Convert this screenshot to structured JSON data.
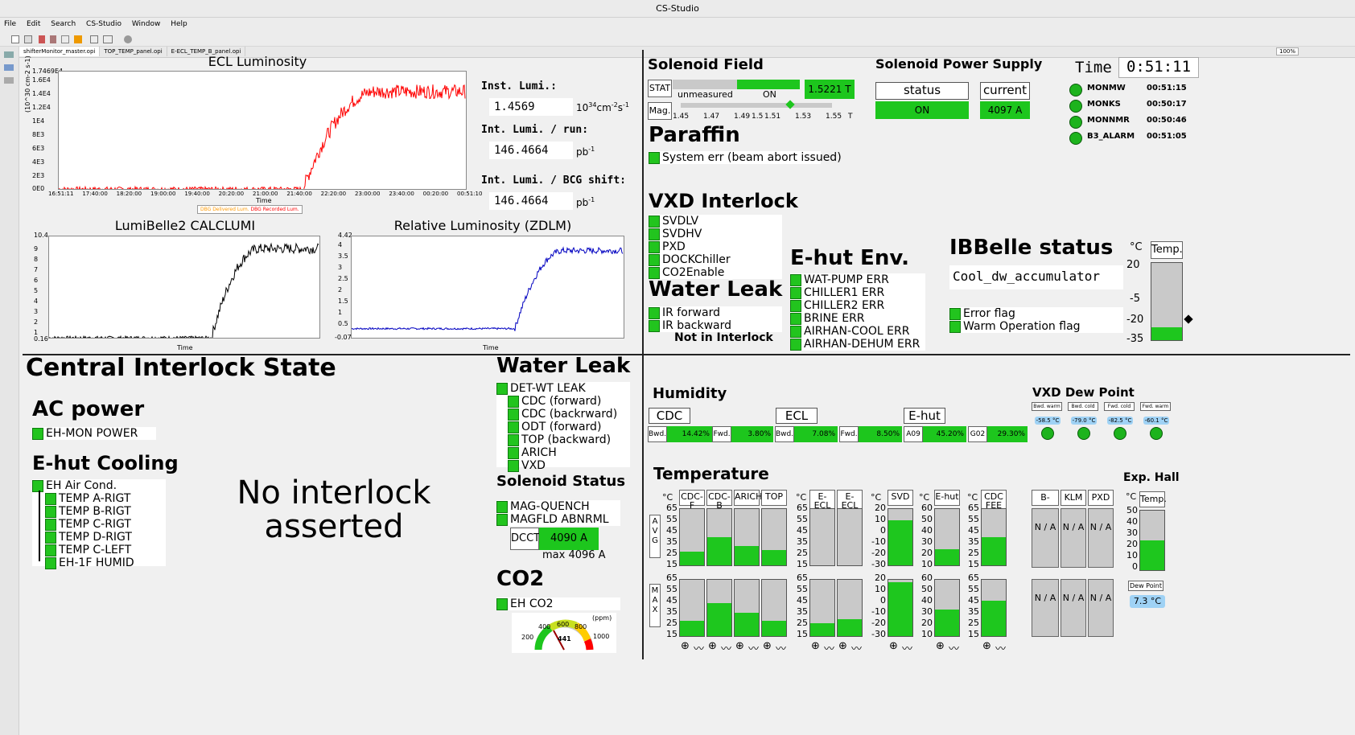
{
  "window": {
    "title": "CS-Studio"
  },
  "menu": [
    "File",
    "Edit",
    "Search",
    "CS-Studio",
    "Window",
    "Help"
  ],
  "tabs": [
    "shifterMonitor_master.opi",
    "TOP_TEMP_panel.opi",
    "E-ECL_TEMP_B_panel.opi"
  ],
  "zoom": "100%",
  "ecl": {
    "title": "ECL Luminosity",
    "ymax_label": "1.7469E4",
    "yticks": [
      "1.6E4",
      "1.4E4",
      "1.2E4",
      "1E4",
      "8E3",
      "6E3",
      "4E3",
      "2E3",
      "0E0"
    ],
    "ylabel": "(10^30 cm-2 s-1)",
    "xticks": [
      "16:51:11",
      "17:40:00",
      "18:20:00",
      "19:00:00",
      "19:40:00",
      "20:20:00",
      "21:00:00",
      "21:40:00",
      "22:20:00",
      "23:00:00",
      "23:40:00",
      "00:20:00",
      "00:51:10"
    ],
    "xlabel": "Time",
    "legend": [
      "DBG Delivered Lum.",
      "DBG Recorded Lum."
    ]
  },
  "lumi": {
    "inst_label": "Inst. Lumi.:",
    "inst_value": "1.4569",
    "inst_unit": "10",
    "inst_unit_exp": "34",
    "inst_unit2": "cm",
    "inst_unit2_exp": "-2",
    "inst_unit3": "s",
    "inst_unit3_exp": "-1",
    "run_label": "Int. Lumi. / run:",
    "run_value": "146.4664",
    "run_unit": "pb",
    "run_unit_exp": "-1",
    "bcg_label": "Int. Lumi. / BCG shift:",
    "bcg_value": "146.4664",
    "bcg_unit": "pb",
    "bcg_unit_exp": "-1"
  },
  "calclumi": {
    "title": "LumiBelle2 CALCLUMI",
    "ymax_label": "10.4",
    "yticks": [
      "9",
      "8",
      "7",
      "6",
      "5",
      "4",
      "3",
      "2",
      "1"
    ],
    "ymin_label": "0.16",
    "xlabel": "Time"
  },
  "zdlm": {
    "title": "Relative Luminosity (ZDLM)",
    "ymax_label": "4.42",
    "yticks": [
      "4",
      "3.5",
      "3",
      "2.5",
      "2",
      "1.5",
      "1",
      "0.5"
    ],
    "ymin_label": "-0.07",
    "xlabel": "Time"
  },
  "solenoid_field": {
    "title": "Solenoid Field",
    "stat_label": "STAT",
    "unmeasured": "unmeasured",
    "on": "ON",
    "value": "1.5221",
    "unit": "T",
    "mag_label": "Mag.",
    "scale": [
      "1.45",
      "1.47",
      "1.49",
      "1.5",
      "1.51",
      "1.53",
      "1.55"
    ],
    "scale_unit": "T"
  },
  "solenoid_power": {
    "title": "Solenoid Power Supply",
    "status_label": "status",
    "current_label": "current",
    "status_value": "ON",
    "current_value": "4097 A"
  },
  "time": {
    "label": "Time",
    "value": "0:51:11"
  },
  "monitors": [
    {
      "name": "MONMW",
      "time": "00:51:15"
    },
    {
      "name": "MONKS",
      "time": "00:50:17"
    },
    {
      "name": "MONNMR",
      "time": "00:50:46"
    },
    {
      "name": "B3_ALARM",
      "time": "00:51:05"
    }
  ],
  "paraffin": {
    "title": "Paraffin",
    "items": [
      "System err (beam abort issued)"
    ]
  },
  "vxd_interlock": {
    "title": "VXD Interlock",
    "items": [
      "SVDLV",
      "SVDHV",
      "PXD",
      "DOCKChiller",
      "CO2Enable"
    ]
  },
  "water_leak_top": {
    "title": "Water Leak",
    "items": [
      "IR forward",
      "IR backward"
    ],
    "note": "Not in Interlock"
  },
  "ehut_env": {
    "title": "E-hut Env.",
    "items": [
      "WAT-PUMP ERR",
      "CHILLER1 ERR",
      "CHILLER2 ERR",
      "BRINE ERR",
      "AIRHAN-COOL ERR",
      "AIRHAN-DEHUM ERR"
    ]
  },
  "ibbelle": {
    "title": "IBBelle status",
    "state": "Cool_dw_accumulator",
    "flags": [
      "Error flag",
      "Warm Operation flag"
    ],
    "temp_unit": "°C",
    "temp_label": "Temp.",
    "scale": [
      "20",
      "-5",
      "-20",
      "-35"
    ],
    "level": 0.17
  },
  "central": {
    "title": "Central Interlock State",
    "ac_title": "AC power",
    "ac_items": [
      "EH-MON POWER"
    ],
    "cooling_title": "E-hut Cooling",
    "cooling_items": [
      "EH Air Cond.",
      "TEMP A-RIGT",
      "TEMP B-RIGT",
      "TEMP C-RIGT",
      "TEMP D-RIGT",
      "TEMP C-LEFT",
      "EH-1F HUMID"
    ],
    "message_line1": "No interlock",
    "message_line2": "asserted"
  },
  "water_leak_bottom": {
    "title": "Water Leak",
    "items": [
      "DET-WT LEAK",
      "CDC (forward)",
      "CDC (backrward)",
      "ODT (forward)",
      "TOP (backward)",
      "ARICH",
      "VXD"
    ]
  },
  "solenoid_status": {
    "title": "Solenoid Status",
    "items": [
      "MAG-QUENCH",
      "MAGFLD ABNRML"
    ],
    "dcct_label": "DCCT",
    "dcct_value": "4090 A",
    "max_label": "max 4096 A"
  },
  "co2": {
    "title": "CO2",
    "items": [
      "EH CO2"
    ],
    "unit": "(ppm)",
    "scale": [
      "200",
      "400",
      "600",
      "800",
      "1000"
    ],
    "value": "441"
  },
  "humidity": {
    "title": "Humidity",
    "groups": [
      {
        "name": "CDC",
        "cells": [
          {
            "label": "Bwd.",
            "value": "14.42%"
          },
          {
            "label": "Fwd.",
            "value": "3.80%"
          }
        ]
      },
      {
        "name": "ECL",
        "cells": [
          {
            "label": "Bwd.",
            "value": "7.08%"
          },
          {
            "label": "Fwd.",
            "value": "8.50%"
          }
        ]
      },
      {
        "name": "E-hut",
        "cells": [
          {
            "label": "A09",
            "value": "45.20%"
          },
          {
            "label": "G02",
            "value": "29.30%"
          }
        ]
      }
    ]
  },
  "vxd_dew": {
    "title": "VXD Dew Point",
    "items": [
      {
        "label": "Bwd. warm",
        "value": "-58.5 °C"
      },
      {
        "label": "Bwd. cold",
        "value": "-79.0 °C"
      },
      {
        "label": "Fwd. cold",
        "value": "-82.5 °C"
      },
      {
        "label": "Fwd. warm",
        "value": "-60.1 °C"
      }
    ]
  },
  "temperature": {
    "title": "Temperature",
    "unit": "°C",
    "avg_label": "A V G",
    "max_label": "M A X",
    "group1": {
      "cols": [
        "CDC-F",
        "CDC-B",
        "ARICH",
        "TOP"
      ],
      "scale": [
        "65",
        "55",
        "45",
        "35",
        "25",
        "15"
      ],
      "avg": [
        0.25,
        0.5,
        0.35,
        0.27
      ],
      "max": [
        0.27,
        0.58,
        0.41,
        0.27
      ]
    },
    "group2": {
      "cols": [
        "E-ECL F.",
        "E-ECL B."
      ],
      "scale": [
        "65",
        "55",
        "45",
        "35",
        "25",
        "15"
      ],
      "avg": [
        0,
        0
      ],
      "max": [
        0.23,
        0.3
      ]
    },
    "svd": {
      "col": "SVD",
      "scale": [
        "20",
        "10",
        "0",
        "-10",
        "-20",
        "-30"
      ],
      "avg": 0.8,
      "max": 0.96
    },
    "ehut": {
      "col": "E-hut",
      "scale": [
        "60",
        "50",
        "40",
        "30",
        "20",
        "10"
      ],
      "avg": 0.28,
      "max": 0.47
    },
    "cdcfee": {
      "col": "CDC FEE",
      "scale": [
        "65",
        "55",
        "45",
        "35",
        "25",
        "15"
      ],
      "avg": 0.5,
      "max": 0.63
    }
  },
  "exphall": {
    "title": "Exp. Hall",
    "cols": [
      "B-ECL",
      "KLM",
      "PXD"
    ],
    "na": "N / A",
    "temp_unit": "°C",
    "temp_label": "Temp.",
    "scale": [
      "50",
      "40",
      "30",
      "20",
      "10",
      "0"
    ],
    "level": 0.5,
    "dew_label": "Dew Point",
    "dew_value": "7.3 °C"
  },
  "colors": {
    "green": "#1dc61d",
    "red": "#ff0000",
    "blue": "#0000c0"
  }
}
